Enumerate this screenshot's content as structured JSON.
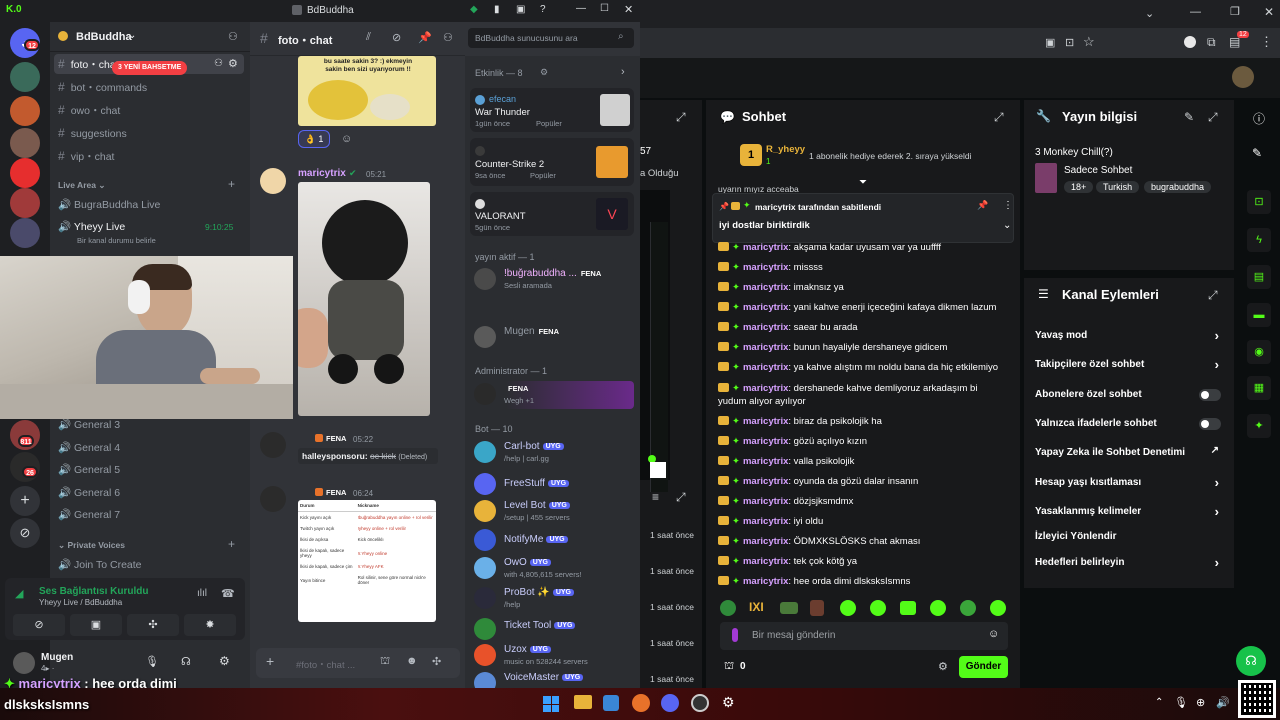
{
  "app_badge": "K.0",
  "discord": {
    "window_title": "BdBuddha",
    "server_name": "BdBuddha",
    "search_placeholder": "BdBuddha sunucusunu ara",
    "current_channel": "foto・chat",
    "mention_badge": "3 YENİ BAHSETME",
    "rail_badges": [
      "12",
      "811",
      "26"
    ],
    "text_channels": [
      {
        "name": "foto・chat",
        "active": true
      },
      {
        "name": "bot・commands"
      },
      {
        "name": "owo・chat"
      },
      {
        "name": "suggestions"
      },
      {
        "name": "vip・chat"
      }
    ],
    "live_category": "Live Area",
    "live_channels": [
      {
        "name": "BugraBuddha Live",
        "status": ""
      },
      {
        "name": "Yheyy Live",
        "status": "Bir kanal durumu belirle",
        "time": "9:10:25"
      }
    ],
    "general_channels": [
      "General 3",
      "General 4",
      "General 5",
      "General 6",
      "General 7"
    ],
    "private_category": "Private Voices",
    "join_to_create": "Join To Create",
    "voice_status": {
      "title": "Ses Bağlantısı Kuruldu",
      "subtitle": "Yheyy Live / BdBuddha"
    },
    "user": {
      "name": "Mugen",
      "status": "4▸ ·"
    },
    "messages": [
      {
        "author": "maricytrix",
        "time": "05:21",
        "reaction_count": "1"
      },
      {
        "author": "",
        "tag": "FENA",
        "time": "05:22",
        "text": "halleysponsoru:",
        "struck": "oc kick",
        "note": "(Deleted)"
      },
      {
        "author": "",
        "tag": "FENA",
        "time": "06:24"
      }
    ],
    "image_text_top": "bu saate sakin 3? :) ekmeyin sakin ben sizi uyarıyorum !!",
    "doc_table": {
      "headers": [
        "Durum",
        "Nickname"
      ],
      "rows": [
        [
          "Kick yayını açık",
          "!buğrabuddha yayın online + rol verilir"
        ],
        [
          "Twitch yayın açık",
          "!yheyy online + rol verilir"
        ],
        [
          "İkisi de açıksa",
          "Kick önceliklı"
        ],
        [
          "İkisi de kapalı, sadece yheyy",
          "!r.Yheyy online"
        ],
        [
          "İkisi de kapalı, sadece çim",
          "!r.Yheyy AFK"
        ],
        [
          "Yayın bitince",
          "Rol silinir, sene göre normal nick'e döner"
        ]
      ]
    },
    "composer_placeholder": "#foto・chat ...",
    "members": {
      "activity_header": "Etkinlik — 8",
      "activities": [
        {
          "name": "efecan",
          "game": "War Thunder",
          "meta": "1gün önce",
          "tag": "Popüler"
        },
        {
          "name": "",
          "game": "Counter-Strike 2",
          "meta": "9sa önce",
          "tag": "Popüler"
        },
        {
          "name": "",
          "game": "VALORANT",
          "meta": "5gün önce",
          "tag": ""
        }
      ],
      "live_header": "yayın aktif — 1",
      "live_members": [
        {
          "name": "!buğrabuddha ...",
          "tag": "FENA",
          "sub": "Sesli aramada"
        }
      ],
      "misc_members": [
        {
          "name": "Mugen",
          "tag": "FENA"
        }
      ],
      "admin_header": "Administrator — 1",
      "admins": [
        {
          "name": "",
          "tag": "FENA",
          "sub": "Wegh +1"
        }
      ],
      "bot_header": "Bot — 10",
      "bots": [
        {
          "name": "Carl-bot",
          "sub": "/help | carl.gg"
        },
        {
          "name": "FreeStuff",
          "sub": ""
        },
        {
          "name": "Level Bot",
          "sub": "/setup | 455 servers"
        },
        {
          "name": "NotifyMe",
          "sub": ""
        },
        {
          "name": "OwO",
          "sub": "with 4,805,615 servers!"
        },
        {
          "name": "ProBot",
          "sub": "/help"
        },
        {
          "name": "Ticket Tool",
          "sub": ""
        },
        {
          "name": "Uzox",
          "sub": "music on 528244 servers"
        },
        {
          "name": "VoiceMaster",
          "sub": ""
        }
      ],
      "bot_tag": "UYG"
    }
  },
  "overlay": {
    "user": "maricytrix",
    "message": "hee orda dimi dlsksksIsmns",
    "line1": "maricytrix : hee orda dimi",
    "line2": "dlsksksIsmns"
  },
  "kick": {
    "partial_left": [
      "57",
      "a Olduğu"
    ],
    "chat_title": "Sohbet",
    "top_gifter": {
      "name": "R_yheyy",
      "count": "1",
      "message": "1 abonelik hediye ederek 2. sıraya yükseldi"
    },
    "scrolled_text": "uyarın mıyız acceaba",
    "pinned": {
      "by": "maricytrix tarafından sabitlendi",
      "text": "iyi dostlar biriktirdik"
    },
    "chat_messages": [
      {
        "user": "maricytrix",
        "text": "akşama kadar uyusam var ya uuffff"
      },
      {
        "user": "maricytrix",
        "text": "missss"
      },
      {
        "user": "maricytrix",
        "text": "imaknsız ya"
      },
      {
        "user": "maricytrix",
        "text": "yani kahve enerji içeceğini kafaya dikmen lazum"
      },
      {
        "user": "maricytrix",
        "text": "saear bu arada"
      },
      {
        "user": "maricytrix",
        "text": "bunun hayaliyle dershaneye gidicem"
      },
      {
        "user": "maricytrix",
        "text": "ya kahve alıştım mı noldu bana da hiç etkilemiyo"
      },
      {
        "user": "maricytrix",
        "text": "dershanede kahve demliyoruz arkadaşım bi yudum alıyor ayılıyor"
      },
      {
        "user": "maricytrix",
        "text": "biraz da psikolojik ha"
      },
      {
        "user": "maricytrix",
        "text": "gözü açılıyo kızın"
      },
      {
        "user": "maricytrix",
        "text": "valla psikolojik"
      },
      {
        "user": "maricytrix",
        "text": "oyunda da gözü dalar insanın"
      },
      {
        "user": "maricytrix",
        "text": "dözjsjksmdmx"
      },
      {
        "user": "maricytrix",
        "text": "iyi oldu"
      },
      {
        "user": "maricytrix",
        "text": "ÖDMXKSLÖSKS chat akması"
      },
      {
        "user": "maricytrix",
        "text": "tek çok kötğ ya"
      },
      {
        "user": "maricytrix",
        "text": "hee orda dimi dlsksksIsmns"
      }
    ],
    "chat_placeholder": "Bir mesaj gönderin",
    "points": "0",
    "send_label": "Gönder",
    "time_ago": [
      "1 saat önce",
      "1 saat önce",
      "1 saat önce",
      "1 saat önce",
      "1 saat önce"
    ],
    "stream_info_title": "Yayın bilgisi",
    "stream_title": "3 Monkey Chill(?)",
    "category": "Sadece Sohbet",
    "tags": [
      "18+",
      "Turkish",
      "bugrabuddha"
    ],
    "actions_title": "Kanal Eylemleri",
    "actions": [
      {
        "label": "Yavaş mod",
        "kind": "chevron"
      },
      {
        "label": "Takipçilere özel sohbet",
        "kind": "chevron"
      },
      {
        "label": "Abonelere özel sohbet",
        "kind": "toggle"
      },
      {
        "label": "Yalnızca ifadelerle sohbet",
        "kind": "toggle"
      },
      {
        "label": "Yapay Zeka ile Sohbet Denetimi",
        "kind": "external"
      },
      {
        "label": "Hesap yaşı kısıtlaması",
        "kind": "chevron"
      },
      {
        "label": "Yasaklanmış kelimeler",
        "kind": "chevron"
      },
      {
        "label": "İzleyici Yönlendir",
        "kind": "none"
      },
      {
        "label": "Hedefleri belirleyin",
        "kind": "chevron"
      }
    ]
  },
  "taskbar": {
    "tray_badge": "12"
  },
  "colors": {
    "kick_green": "#53fc18",
    "discord_blurple": "#5865f2",
    "mention_red": "#f23f43",
    "user_purple": "#d6a1ff"
  }
}
